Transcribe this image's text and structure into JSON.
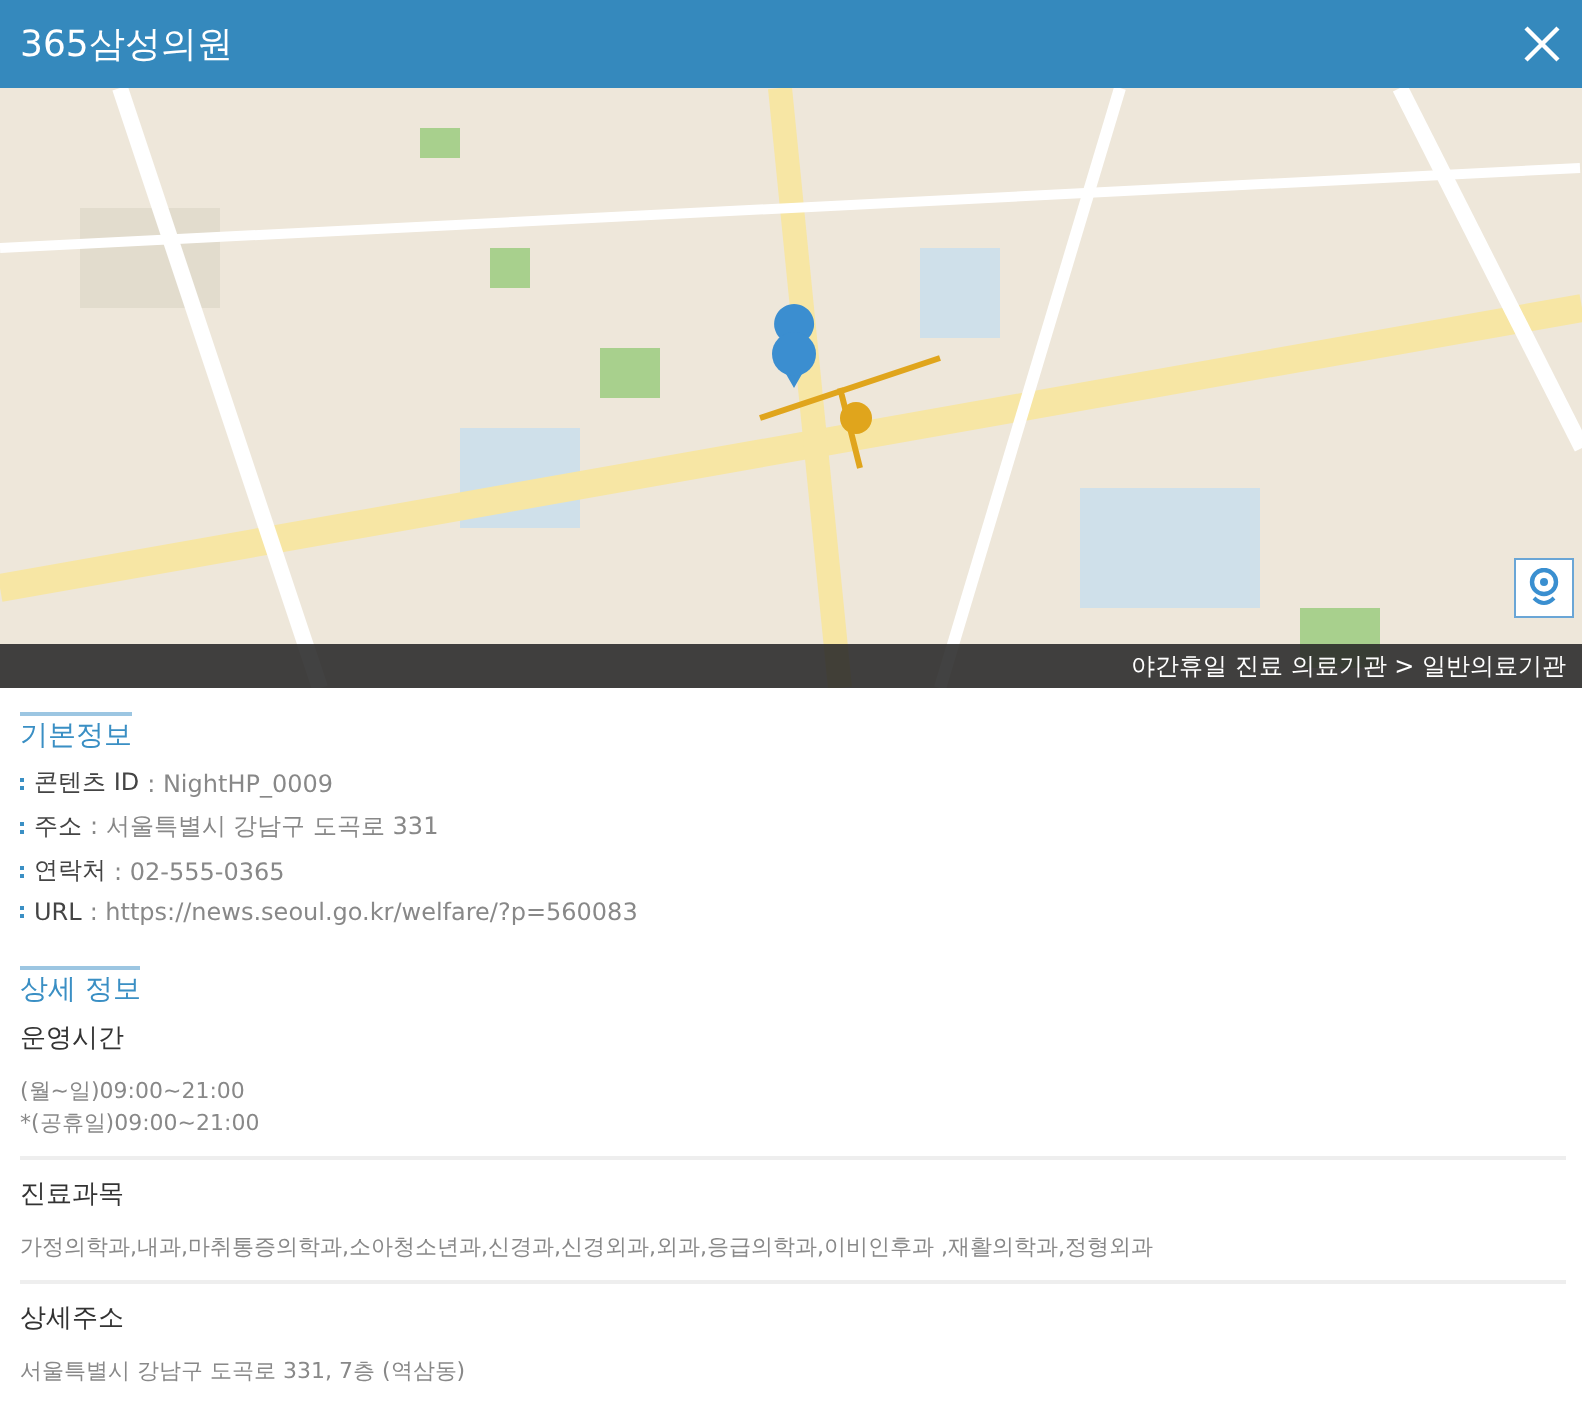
{
  "window": {
    "title": "365삼성의원"
  },
  "map": {
    "breadcrumb": "야간휴일 진료 의료기관 > 일반의료기관"
  },
  "basic_info": {
    "heading": "기본정보",
    "items": [
      {
        "label": "콘텐츠 ID",
        "value": ": NightHP_0009"
      },
      {
        "label": "주소",
        "value": ": 서울특별시 강남구 도곡로 331"
      },
      {
        "label": "연락처",
        "value": ": 02-555-0365"
      },
      {
        "label": "URL",
        "value": ": https://news.seoul.go.kr/welfare/?p=560083"
      }
    ]
  },
  "detail_info": {
    "heading": "상세 정보",
    "groups": [
      {
        "title": "운영시간",
        "lines": [
          "(월~일)09:00~21:00",
          "*(공휴일)09:00~21:00"
        ]
      },
      {
        "title": "진료과목",
        "lines": [
          "가정의학과,내과,마취통증의학과,소아청소년과,신경과,신경외과,외과,응급의학과,이비인후과 ,재활의학과,정형외과"
        ]
      },
      {
        "title": "상세주소",
        "lines": [
          "서울특별시 강남구 도곡로 331, 7층 (역삼동)"
        ]
      }
    ]
  }
}
